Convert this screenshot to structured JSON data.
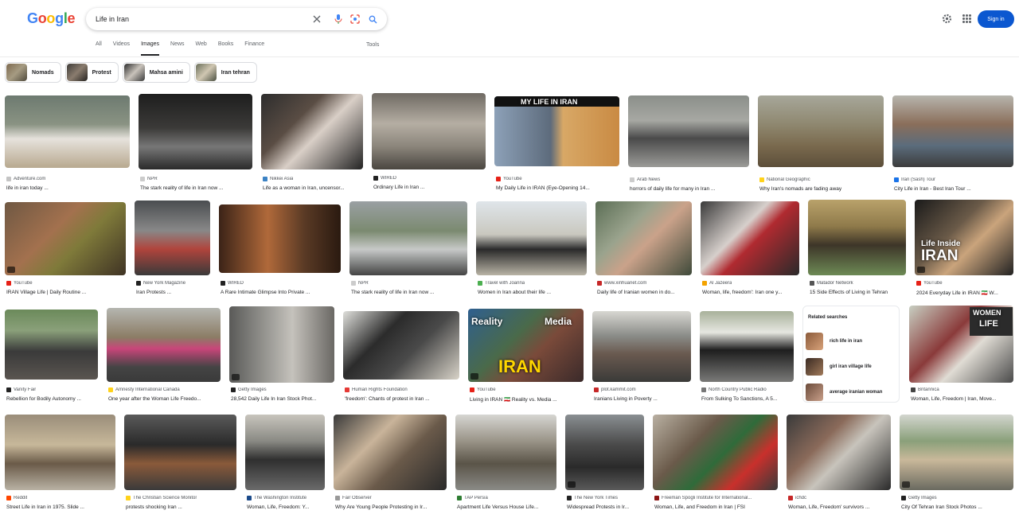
{
  "header": {
    "logo": [
      "G",
      "o",
      "o",
      "g",
      "l",
      "e"
    ],
    "search_value": "Life in Iran",
    "tabs": [
      "All",
      "Videos",
      "Images",
      "News",
      "Web",
      "Books",
      "Finance"
    ],
    "tools": "Tools",
    "sign_in": "Sign in"
  },
  "chips": [
    {
      "label": "Nomads"
    },
    {
      "label": "Protest"
    },
    {
      "label": "Mahsa amini"
    },
    {
      "label": "Iran tehran"
    }
  ],
  "results": {
    "row1": [
      {
        "source": "Adventure.com",
        "title": "life in iran today ..."
      },
      {
        "source": "NPR",
        "title": "The stark reality of life in Iran now ..."
      },
      {
        "source": "Nikkei Asia",
        "title": "Life as a woman in Iran, uncensor..."
      },
      {
        "source": "WIRED",
        "title": "Ordinary Life in Iran ..."
      },
      {
        "source": "YouTube",
        "title": "My Daily Life in IRAN (Eye-Opening 14...",
        "overlay": "MY LIFE IN IRAN"
      },
      {
        "source": "Arab News",
        "title": "horrors of daily life for many in Iran ..."
      },
      {
        "source": "National Geographic",
        "title": "Why Iran's nomads are fading away"
      },
      {
        "source": "Iran (Sash) Tour",
        "title": "City Life in Iran - Best Iran Tour ..."
      }
    ],
    "row2": [
      {
        "source": "YouTube",
        "title": "IRAN Village Life | Daily Routine ..."
      },
      {
        "source": "New York Magazine",
        "title": "Iran Protests ..."
      },
      {
        "source": "WIRED",
        "title": "A Rare Intimate Glimpse Into Private ..."
      },
      {
        "source": "NPR",
        "title": "The stark reality of life in Iran now ..."
      },
      {
        "source": "Travel with Joanna",
        "title": "Women in Iran about their life ..."
      },
      {
        "source": "www.xinhuanet.com",
        "title": "Daily life of Iranian women in do..."
      },
      {
        "source": "Al Jazeera",
        "title": "Woman, life, freedom': Iran one y..."
      },
      {
        "source": "Matador Network",
        "title": "15 Side Effects of Living in Tehran"
      },
      {
        "source": "YouTube",
        "title": "2024 Everyday Life in IRAN 🇮🇷 W...",
        "overlay1": "Life Inside",
        "overlay2": "IRAN"
      }
    ],
    "row3": [
      {
        "source": "Vanity Fair",
        "title": "Rebellion for Bodily Autonomy ..."
      },
      {
        "source": "Amnesty International Canada",
        "title": "One year after the Woman Life Freedo..."
      },
      {
        "source": "Getty Images",
        "title": "28,542 Daily Life In Iran Stock Phot..."
      },
      {
        "source": "Human Rights Foundation",
        "title": "'freedom': Chants of protest in Iran ..."
      },
      {
        "source": "YouTube",
        "title": "Living in IRAN 🇮🇷 Reality vs. Media ...",
        "overlay1": "Reality",
        "overlay2": "Media",
        "overlay3": "IRAN"
      },
      {
        "source": "plot.kammit.com",
        "title": "Iranians Living in Poverty ..."
      },
      {
        "source": "North Country Public Radio",
        "title": "From Sulking To Sanctions, A 5..."
      },
      {
        "source": "Britannica",
        "title": "Woman, Life, Freedom | Iran, Move...",
        "overlay1": "WOMEN",
        "overlay2": "LIFE"
      }
    ],
    "row4": [
      {
        "source": "Reddit",
        "title": "Street Life in Iran in 1975. Slide ..."
      },
      {
        "source": "The Christian Science Monitor",
        "title": "protests shocking Iran ..."
      },
      {
        "source": "The Washington Institute",
        "title": "Woman, Life, Freedom: Y..."
      },
      {
        "source": "Fair Observer",
        "title": "Why Are Young People Protesting in Ir..."
      },
      {
        "source": "TAP Persia",
        "title": "Apartment Life Versus House Life..."
      },
      {
        "source": "The New York Times",
        "title": "Widespread Protests in Ir..."
      },
      {
        "source": "Freeman Spogli Institute for International...",
        "title": "Woman, Life, and Freedom in Iran | FSI"
      },
      {
        "source": "ichdc",
        "title": "Woman, Life, Freedom' survivors ..."
      },
      {
        "source": "Getty Images",
        "title": "City Of Tehran Iran Stock Photos ..."
      }
    ]
  },
  "related": {
    "title": "Related searches",
    "items": [
      "rich life in iran",
      "girl iran village life",
      "average iranian woman"
    ]
  }
}
